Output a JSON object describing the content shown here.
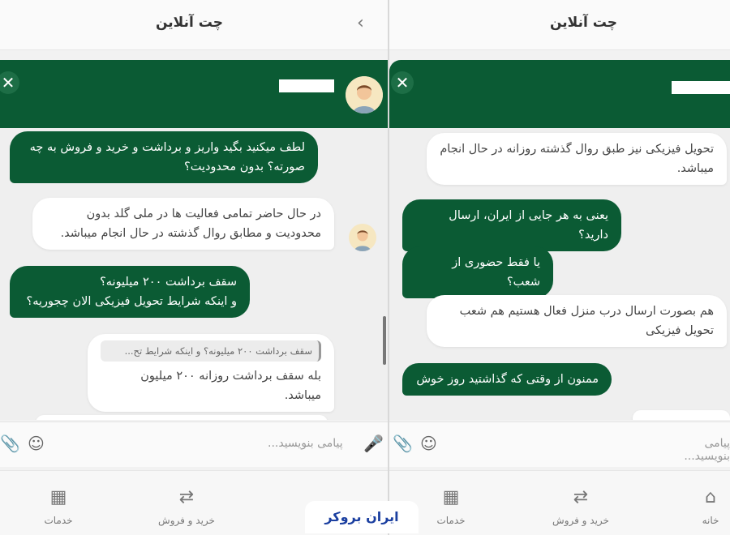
{
  "left": {
    "page_title": "چت آنلاین",
    "back_icon": "chevron-left-icon",
    "messages": [
      {
        "dir": "out",
        "lines": [
          "لطف میکنید بگید واریز و برداشت و خرید و فروش به چه",
          "صورته؟ بدون محدودیت؟"
        ]
      },
      {
        "dir": "in",
        "lines": [
          "در حال حاضر تمامی فعالیت ها در ملی گلد بدون",
          "محدودیت و مطابق روال گذشته در حال انجام میباشد."
        ]
      },
      {
        "dir": "out",
        "lines": [
          "سقف برداشت ۲۰۰ میلیونه؟",
          "و اینکه شرایط تحویل فیزیکی الان چجوریه؟"
        ]
      },
      {
        "dir": "in",
        "quote": "سقف برداشت ۲۰۰ میلیونه؟ و اینکه شرایط تح...",
        "lines": [
          "بله سقف برداشت روزانه ۲۰۰ میلیون میباشد."
        ]
      }
    ],
    "composer_placeholder": "پیامی بنویسید...",
    "nav": [
      {
        "label": "خدمات",
        "icon": "grid-icon"
      },
      {
        "label": "خرید و فروش",
        "icon": "swap-arrows-icon"
      }
    ]
  },
  "right": {
    "page_title": "چت آنلاین",
    "messages": [
      {
        "dir": "in",
        "lines": [
          "تحویل فیزیکی نیز طبق روال گذشته روزانه در حال انجام",
          "میباشد."
        ]
      },
      {
        "dir": "out",
        "lines": [
          "یعنی به هر جایی از ایران، ارسال دارید؟"
        ]
      },
      {
        "dir": "out",
        "lines": [
          "یا فقط حضوری از شعب؟"
        ]
      },
      {
        "dir": "in",
        "lines": [
          "هم بصورت ارسال درب منزل فعال هستیم هم شعب",
          "تحویل فیزیکی"
        ]
      },
      {
        "dir": "out",
        "lines": [
          "ممنون از وقتی که گذاشتید روز خوش"
        ]
      }
    ],
    "composer_placeholder": "پیامی بنویسید...",
    "nav": [
      {
        "label": "خدمات",
        "icon": "grid-icon"
      },
      {
        "label": "خرید و فروش",
        "icon": "swap-arrows-icon"
      },
      {
        "label": "خانه",
        "icon": "home-icon"
      }
    ]
  },
  "watermark": "ایران بروکر",
  "colors": {
    "brand_green": "#0b5b34",
    "background": "#efefef"
  }
}
